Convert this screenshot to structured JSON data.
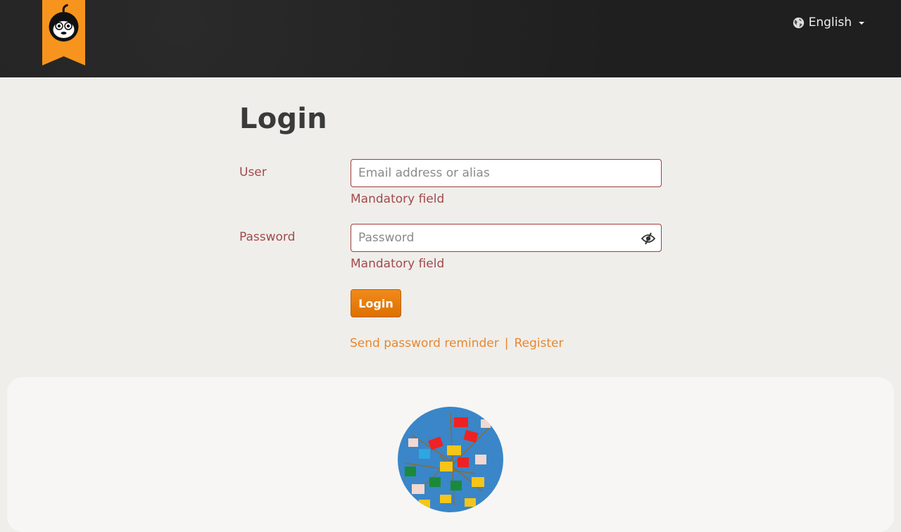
{
  "header": {
    "language_label": "English"
  },
  "form": {
    "title": "Login",
    "user_label": "User",
    "user_placeholder": "Email address or alias",
    "user_error": "Mandatory field",
    "password_label": "Password",
    "password_placeholder": "Password",
    "password_error": "Mandatory field",
    "submit_label": "Login"
  },
  "links": {
    "reminder": "Send password reminder",
    "separator": "|",
    "register": "Register"
  },
  "colors": {
    "brand_orange": "#f7941d",
    "error_red": "#a33c3c",
    "link_orange": "#e8872f",
    "header_bg": "#222222"
  },
  "icons": {
    "logo": "monkey-logo-icon",
    "language": "globe-icon",
    "dropdown": "caret-down-icon",
    "password_toggle": "eye-slash-icon"
  }
}
